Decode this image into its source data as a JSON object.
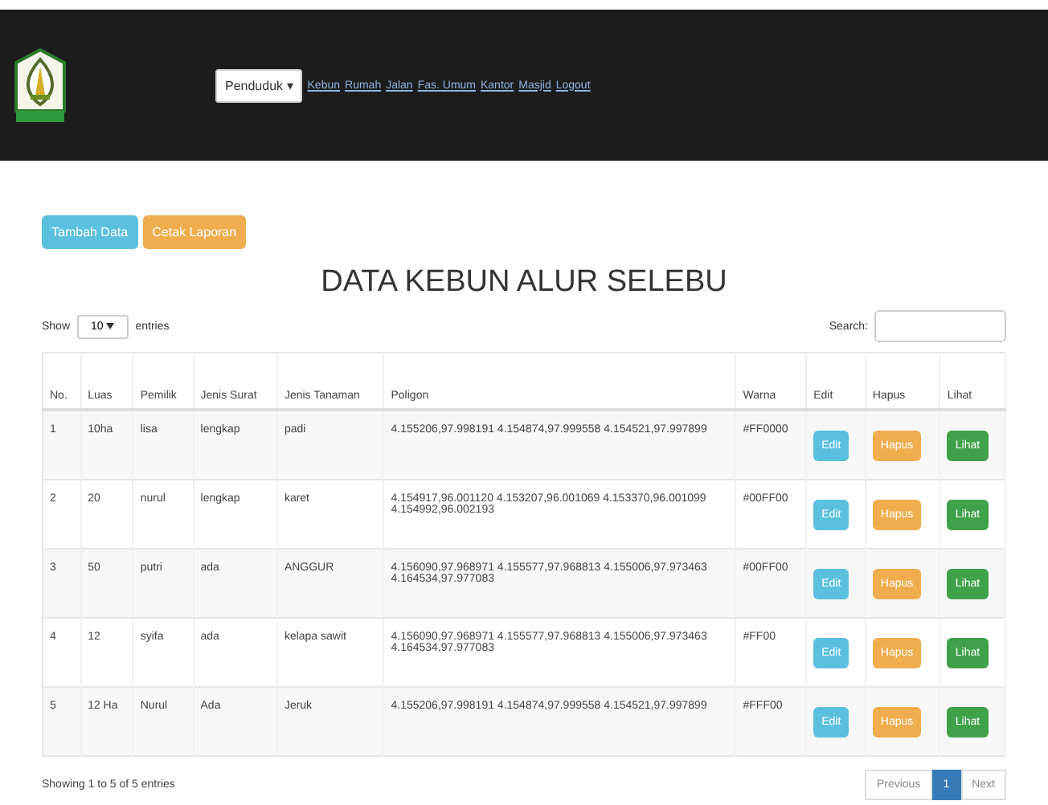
{
  "navbar": {
    "dropdown": "Penduduk ▾",
    "links": [
      "Kebun",
      "Rumah",
      "Jalan",
      "Fas. Umum",
      "Kantor",
      "Masjid",
      "Logout"
    ]
  },
  "actions": [
    {
      "label": "Tambah Data",
      "kind": "info"
    },
    {
      "label": "Cetak Laporan",
      "kind": "warning"
    }
  ],
  "title": "DATA KEBUN ALUR SELEBU",
  "length": {
    "show": "Show",
    "value": "10",
    "entries": "entries"
  },
  "search": {
    "label": "Search:"
  },
  "table": {
    "columns": [
      "No.",
      "Luas",
      "Pemilik",
      "Jenis Surat",
      "Jenis Tanaman",
      "Poligon",
      "Warna",
      "Edit",
      "Hapus",
      "Lihat"
    ],
    "rows": [
      {
        "cells": [
          "1",
          "10ha",
          "lisa",
          "lengkap",
          "padi",
          "4.155206,97.998191 4.154874,97.999558 4.154521,97.997899",
          "#FF0000"
        ],
        "buttons": [
          {
            "label": "Edit",
            "kind": "info"
          },
          {
            "label": "Hapus",
            "kind": "warning"
          },
          {
            "label": "Lihat",
            "kind": "success"
          }
        ]
      },
      {
        "cells": [
          "2",
          "20",
          "nurul",
          "lengkap",
          "karet",
          "4.154917,96.001120 4.153207,96.001069 4.153370,96.001099 4.154992,96.002193",
          "#00FF00"
        ],
        "buttons": [
          {
            "label": "Edit",
            "kind": "info"
          },
          {
            "label": "Hapus",
            "kind": "warning"
          },
          {
            "label": "Lihat",
            "kind": "success"
          }
        ]
      },
      {
        "cells": [
          "3",
          "50",
          "putri",
          "ada",
          "ANGGUR",
          "4.156090,97.968971 4.155577,97.968813 4.155006,97.973463 4.164534,97.977083",
          "#00FF00"
        ],
        "buttons": [
          {
            "label": "Edit",
            "kind": "info"
          },
          {
            "label": "Hapus",
            "kind": "warning"
          },
          {
            "label": "Lihat",
            "kind": "success"
          }
        ]
      },
      {
        "cells": [
          "4",
          "12",
          "syifa",
          "ada",
          "kelapa sawit",
          "4.156090,97.968971 4.155577,97.968813 4.155006,97.973463 4.164534,97.977083",
          "#FF00"
        ],
        "buttons": [
          {
            "label": "Edit",
            "kind": "info"
          },
          {
            "label": "Hapus",
            "kind": "warning"
          },
          {
            "label": "Lihat",
            "kind": "success"
          }
        ]
      },
      {
        "cells": [
          "5",
          "12 Ha",
          "Nurul",
          "Ada",
          "Jeruk",
          "4.155206,97.998191 4.154874,97.999558 4.154521,97.997899",
          "#FFF00"
        ],
        "buttons": [
          {
            "label": "Edit",
            "kind": "info"
          },
          {
            "label": "Hapus",
            "kind": "warning"
          },
          {
            "label": "Lihat",
            "kind": "success"
          }
        ]
      }
    ]
  },
  "info": "Showing 1 to 5 of 5 entries",
  "pagination": [
    {
      "label": "Previous",
      "selected": false
    },
    {
      "label": "1",
      "selected": true
    },
    {
      "label": "Next",
      "selected": false
    }
  ]
}
